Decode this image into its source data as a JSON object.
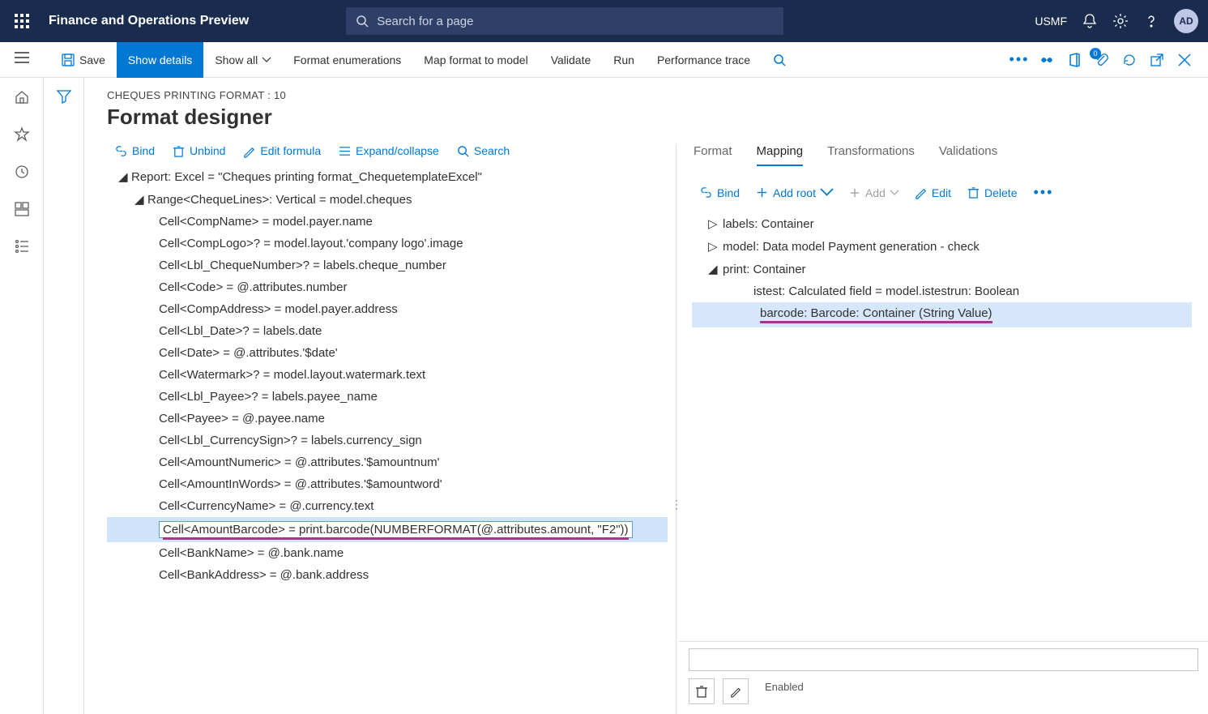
{
  "topbar": {
    "product_title": "Finance and Operations Preview",
    "search_placeholder": "Search for a page",
    "company": "USMF",
    "avatar_initials": "AD"
  },
  "cmdbar": {
    "save": "Save",
    "show_details": "Show details",
    "show_all": "Show all",
    "format_enum": "Format enumerations",
    "map_format": "Map format to model",
    "validate": "Validate",
    "run": "Run",
    "perf_trace": "Performance trace",
    "badge_count": "0"
  },
  "page": {
    "breadcrumb": "CHEQUES PRINTING FORMAT : 10",
    "title": "Format designer"
  },
  "left_toolbar": {
    "bind": "Bind",
    "unbind": "Unbind",
    "edit_formula": "Edit formula",
    "expand_collapse": "Expand/collapse",
    "search": "Search"
  },
  "format_tree": {
    "root": "Report: Excel = \"Cheques printing format_ChequetemplateExcel\"",
    "range": "Range<ChequeLines>: Vertical = model.cheques",
    "cells": [
      "Cell<CompName> = model.payer.name",
      "Cell<CompLogo>? = model.layout.'company logo'.image",
      "Cell<Lbl_ChequeNumber>? = labels.cheque_number",
      "Cell<Code> = @.attributes.number",
      "Cell<CompAddress> = model.payer.address",
      "Cell<Lbl_Date>? = labels.date",
      "Cell<Date> = @.attributes.'$date'",
      "Cell<Watermark>? = model.layout.watermark.text",
      "Cell<Lbl_Payee>? = labels.payee_name",
      "Cell<Payee> = @.payee.name",
      "Cell<Lbl_CurrencySign>? = labels.currency_sign",
      "Cell<AmountNumeric> = @.attributes.'$amountnum'",
      "Cell<AmountInWords> = @.attributes.'$amountword'",
      "Cell<CurrencyName> = @.currency.text"
    ],
    "selected_cell": "Cell<AmountBarcode> = print.barcode(NUMBERFORMAT(@.attributes.amount, \"F2\"))",
    "cells_after": [
      "Cell<BankName> = @.bank.name",
      "Cell<BankAddress> = @.bank.address"
    ]
  },
  "tabs": {
    "format": "Format",
    "mapping": "Mapping",
    "transformations": "Transformations",
    "validations": "Validations"
  },
  "right_toolbar": {
    "bind": "Bind",
    "add_root": "Add root",
    "add": "Add",
    "edit": "Edit",
    "delete": "Delete"
  },
  "dm_tree": {
    "labels": "labels: Container",
    "model": "model: Data model Payment generation - check",
    "print": "print: Container",
    "istest": "istest: Calculated field = model.istestrun: Boolean",
    "barcode": "barcode: Barcode: Container (String Value)"
  },
  "bottom": {
    "enabled": "Enabled"
  }
}
